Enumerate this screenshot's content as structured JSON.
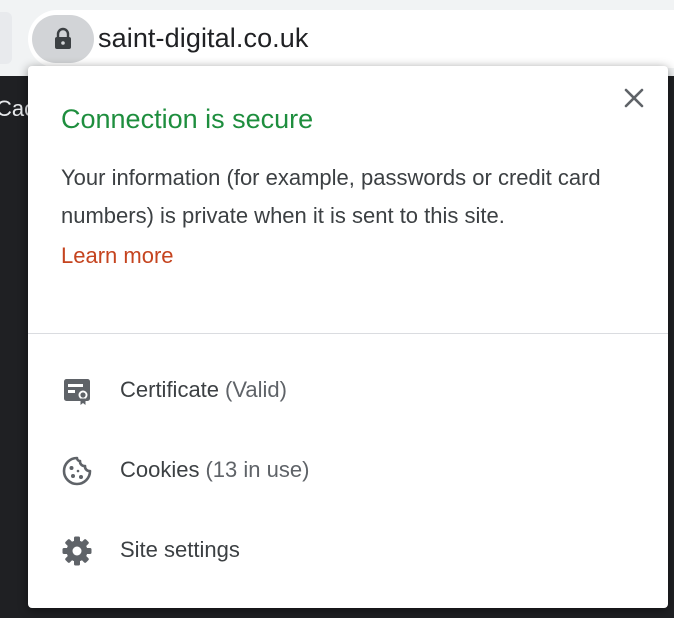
{
  "browser": {
    "url": "saint-digital.co.uk",
    "page_fragment": "Cac"
  },
  "popup": {
    "title": "Connection is secure",
    "description": "Your information (for example, passwords or credit card numbers) is private when it is sent to this site.",
    "learn_more": "Learn more",
    "items": [
      {
        "label": "Certificate",
        "detail": "(Valid)",
        "icon": "certificate-icon"
      },
      {
        "label": "Cookies",
        "detail": "(13 in use)",
        "icon": "cookie-icon"
      },
      {
        "label": "Site settings",
        "detail": "",
        "icon": "gear-icon"
      }
    ]
  },
  "colors": {
    "secure_green": "#1e8e3e",
    "link": "#c5441f",
    "icon_gray": "#5f6368"
  }
}
